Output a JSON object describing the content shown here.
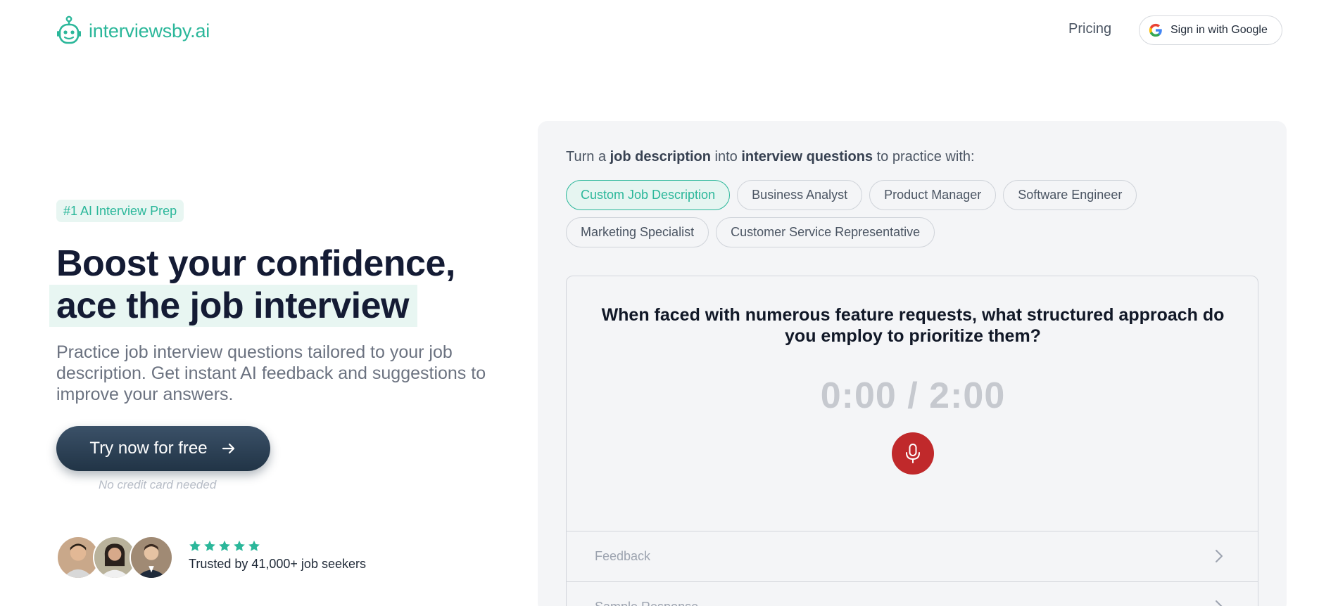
{
  "header": {
    "logo_text": "interviewsby.ai",
    "nav_pricing": "Pricing",
    "google_signin": "Sign in with Google"
  },
  "hero": {
    "badge": "#1 AI Interview Prep",
    "title_line1": "Boost your confidence,",
    "title_line2": "ace the job interview",
    "subtitle": "Practice job interview questions tailored to your job description. Get instant AI feedback and suggestions to improve your answers.",
    "cta_label": "Try now for free",
    "cta_note": "No credit card needed",
    "rating_stars": 5,
    "trusted_text": "Trusted by 41,000+ job seekers"
  },
  "panel": {
    "intro_prefix": "Turn a ",
    "intro_bold1": "job description",
    "intro_mid": " into ",
    "intro_bold2": "interview questions",
    "intro_suffix": " to practice with:",
    "chips": [
      {
        "label": "Custom Job Description",
        "active": true
      },
      {
        "label": "Business Analyst",
        "active": false
      },
      {
        "label": "Product Manager",
        "active": false
      },
      {
        "label": "Software Engineer",
        "active": false
      },
      {
        "label": "Marketing Specialist",
        "active": false
      },
      {
        "label": "Customer Service Representative",
        "active": false
      }
    ],
    "question": "When faced with numerous feature requests, what structured approach do you employ to prioritize them?",
    "timer": "0:00 / 2:00",
    "accordion": [
      {
        "label": "Feedback"
      },
      {
        "label": "Sample Response"
      }
    ]
  },
  "colors": {
    "brand": "#2bb79a",
    "dark": "#141b34",
    "cta": "#2b3f55",
    "mic": "#c0292b"
  },
  "icons": {
    "logo": "robot-icon",
    "google": "google-g-icon",
    "cta": "arrow-right-icon",
    "mic": "microphone-icon",
    "accordion": "chevron-right-icon",
    "rating": "star-icon"
  }
}
